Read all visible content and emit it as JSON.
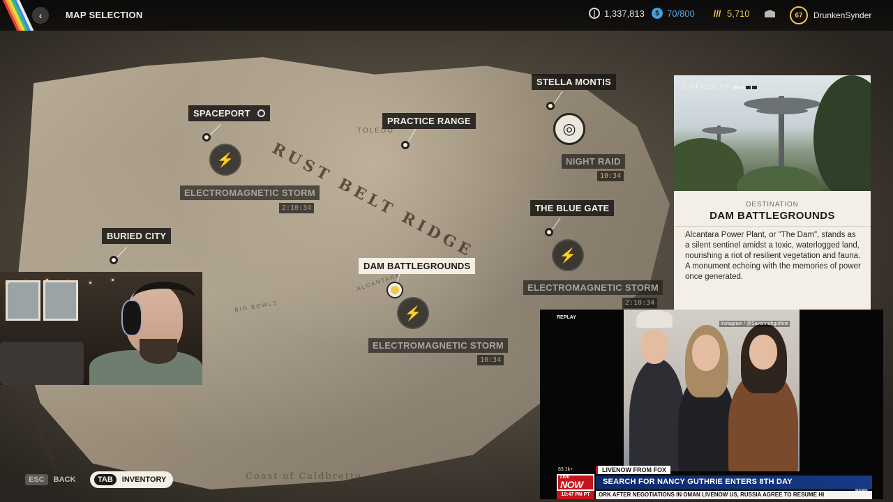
{
  "header": {
    "title": "MAP SELECTION",
    "coins": "1,337,813",
    "tokens": "70/800",
    "credits": "5,710",
    "level": "67",
    "username": "DrunkenSynder"
  },
  "map": {
    "region_labels": [
      "RUST BELT RIDGE"
    ],
    "minor_labels": [
      "TOLEDO",
      "ALCANTARA",
      "BIG BOWLS",
      "LA CARTIERA",
      "Coast of Caldbretto"
    ],
    "locations": [
      {
        "name": "SPACEPORT"
      },
      {
        "name": "PRACTICE RANGE"
      },
      {
        "name": "STELLA MONTIS"
      },
      {
        "name": "THE BLUE GATE"
      },
      {
        "name": "BURIED CITY"
      },
      {
        "name": "DAM BATTLEGROUNDS",
        "selected": true
      }
    ],
    "events": [
      {
        "name": "ELECTROMAGNETIC STORM",
        "timer": "2:10:34"
      },
      {
        "name": "NIGHT RAID",
        "timer": "10:34"
      },
      {
        "name": "ELECTROMAGNETIC STORM",
        "timer": "2:10:34"
      },
      {
        "name": "ELECTROMAGNETIC STORM",
        "timer": "10:34"
      }
    ],
    "icons": {
      "storm": "lightning-icon",
      "raid": "target-icon"
    }
  },
  "info_panel": {
    "difficulty_label": "DIFFICULTY",
    "difficulty_level": 2,
    "difficulty_max": 4,
    "kicker": "DESTINATION",
    "title": "DAM BATTLEGROUNDS",
    "description": "Alcantara Power Plant, or \"The Dam\", stands as a silent sentinel amidst a toxic, waterlogged land, nourishing a riot of resilient vegetation and fauna. A monument echoing with the memories of power once generated."
  },
  "news": {
    "replay": "REPLAY",
    "handle": "Instagram / @Savannahguthrie",
    "viewers": "83.1k+",
    "channel_tag": "LIVENOW FROM FOX",
    "live_small": "LIVE",
    "live_big": "NOW",
    "headline": "SEARCH FOR NANCY GUTHRIE ENTERS 8TH DAY",
    "time": "10:47 PM PT",
    "ticker": "ORK AFTER NEGOTIATIONS IN OMAN  LIVENOW  US, RUSSIA AGREE TO RESUME HI",
    "logo": "NEWS"
  },
  "hints": {
    "esc_key": "ESC",
    "esc_label": "BACK",
    "tab_key": "TAB",
    "tab_label": "INVENTORY"
  },
  "colors": {
    "accent_gold": "#f2c84b",
    "token_blue": "#4a9fd8",
    "news_red": "#c4161c",
    "news_blue": "#0d2a66"
  }
}
